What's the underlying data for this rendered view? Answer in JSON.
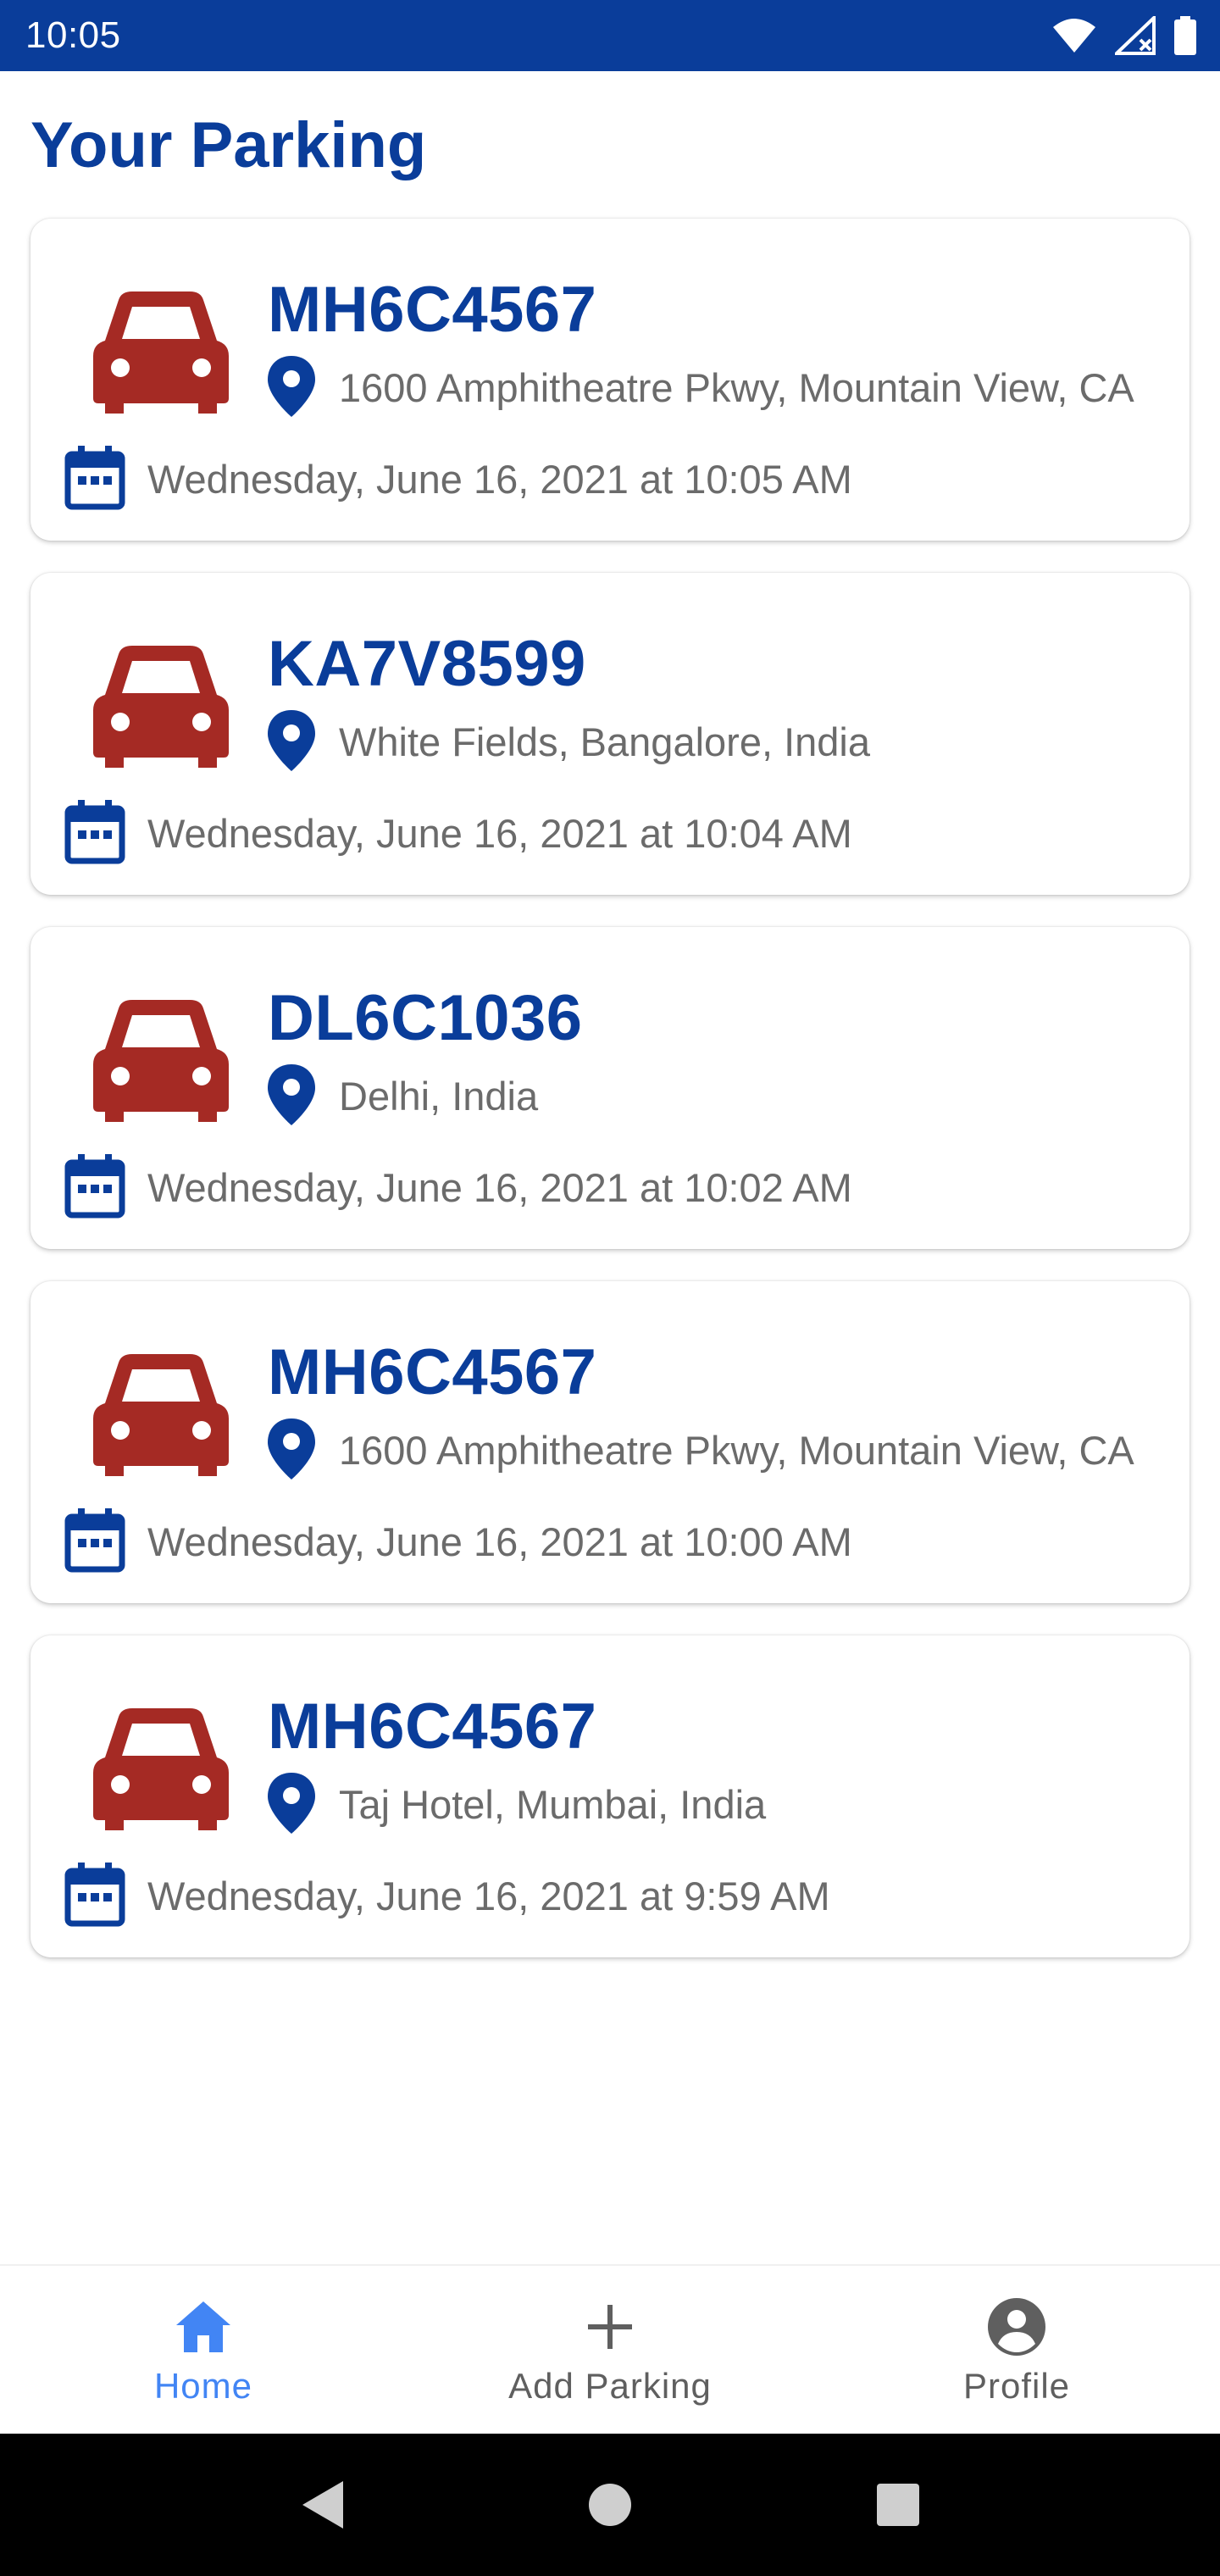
{
  "status_bar": {
    "time": "10:05"
  },
  "page": {
    "title": "Your Parking"
  },
  "colors": {
    "primary": "#0a3d9a",
    "car": "#a52a24",
    "text_secondary": "#6b6b6b",
    "nav_active": "#4285f4"
  },
  "parkings": [
    {
      "plate": "MH6C4567",
      "address": "1600 Amphitheatre Pkwy, Mountain View, CA",
      "datetime": "Wednesday, June 16, 2021 at 10:05 AM"
    },
    {
      "plate": "KA7V8599",
      "address": "White Fields, Bangalore, India",
      "datetime": "Wednesday, June 16, 2021 at 10:04 AM"
    },
    {
      "plate": "DL6C1036",
      "address": "Delhi, India",
      "datetime": "Wednesday, June 16, 2021 at 10:02 AM"
    },
    {
      "plate": "MH6C4567",
      "address": "1600 Amphitheatre Pkwy, Mountain View, CA",
      "datetime": "Wednesday, June 16, 2021 at 10:00 AM"
    },
    {
      "plate": "MH6C4567",
      "address": "Taj Hotel, Mumbai, India",
      "datetime": "Wednesday, June 16, 2021 at 9:59 AM"
    }
  ],
  "bottom_nav": {
    "items": [
      {
        "label": "Home",
        "icon": "home-icon",
        "active": true
      },
      {
        "label": "Add Parking",
        "icon": "plus-icon",
        "active": false
      },
      {
        "label": "Profile",
        "icon": "account-circle-icon",
        "active": false
      }
    ]
  }
}
